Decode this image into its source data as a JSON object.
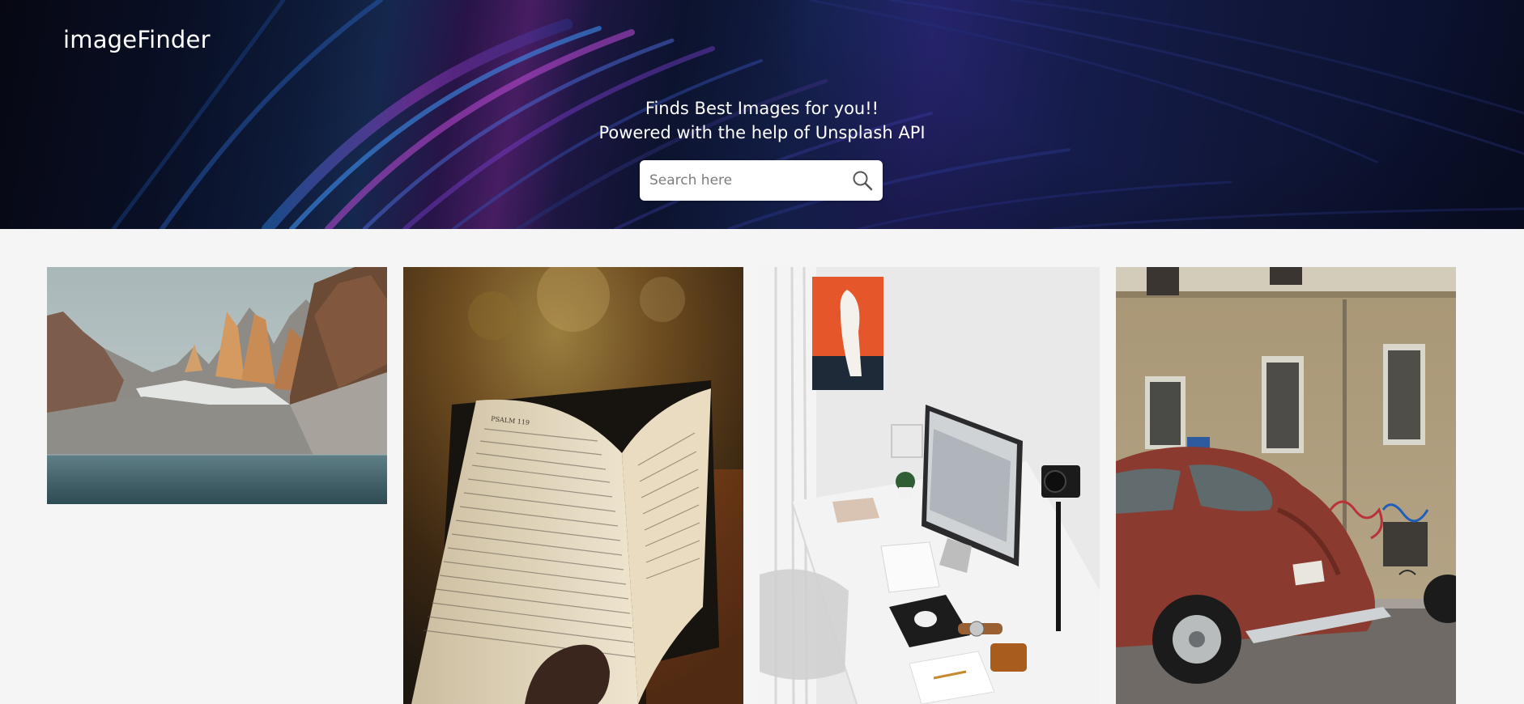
{
  "app": {
    "brand": "imageFinder"
  },
  "hero": {
    "tagline_line1": "Finds Best Images for you!!",
    "tagline_line2": "Powered with the help of Unsplash API"
  },
  "search": {
    "placeholder": "Search here",
    "value": "",
    "icon": "search-icon"
  },
  "gallery": {
    "images": [
      {
        "subject": "mountain lake with granite peaks"
      },
      {
        "subject": "hand holding open book"
      },
      {
        "subject": "white desk setup with monitor and camera"
      },
      {
        "subject": "red vintage beetle car on street"
      }
    ],
    "book_header": "PSALM 119"
  },
  "colors": {
    "page_background": "#f5f5f5",
    "hero_text": "#ffffff",
    "search_background": "#ffffff"
  }
}
